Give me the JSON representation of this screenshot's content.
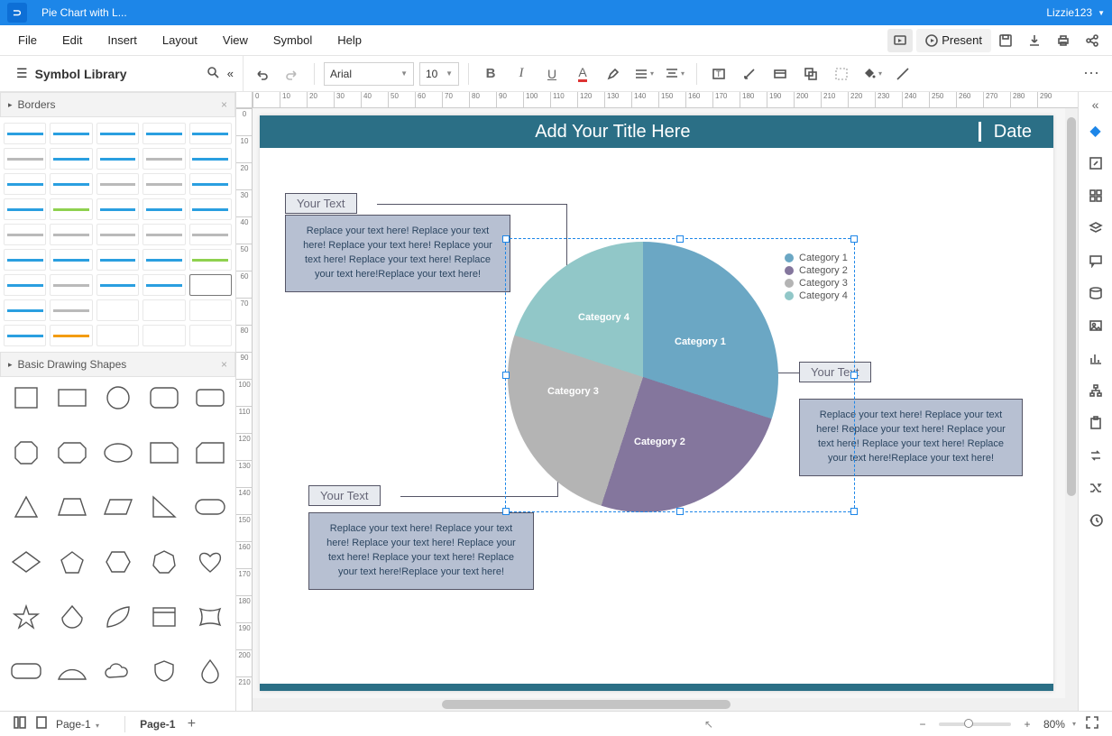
{
  "titlebar": {
    "doc_name": "Pie Chart with L...",
    "user": "Lizzie123"
  },
  "menu": {
    "file": "File",
    "edit": "Edit",
    "insert": "Insert",
    "layout": "Layout",
    "view": "View",
    "symbol": "Symbol",
    "help": "Help",
    "present": "Present"
  },
  "toolbar": {
    "font": "Arial",
    "size": "10"
  },
  "left": {
    "library_title": "Symbol Library",
    "cat_borders": "Borders",
    "cat_shapes": "Basic Drawing Shapes"
  },
  "canvas": {
    "title": "Add Your Title Here",
    "date": "Date",
    "callouts": {
      "tl_label": "Your Text",
      "tl_body": "Replace your text here!   Replace your text here!\nReplace your text here!   Replace your text here!\nReplace your text here!   Replace your text\nhere!Replace your text here!",
      "r_label": "Your Text",
      "r_body": "Replace your text here!   Replace your text here!\nReplace your text here!   Replace your text here!\nReplace your text here!   Replace your text\nhere!Replace your text here!",
      "bl_label": "Your Text",
      "bl_body": "Replace your text here!   Replace your text here!\nReplace your text here!   Replace your text here!\nReplace your text here!   Replace your text\nhere!Replace your text here!"
    },
    "legend": {
      "c1": "Category 1",
      "c2": "Category 2",
      "c3": "Category 3",
      "c4": "Category 4"
    },
    "pie_labels": {
      "c1": "Category 1",
      "c2": "Category 2",
      "c3": "Category 3",
      "c4": "Category 4"
    }
  },
  "chart_data": {
    "type": "pie",
    "title": "Add Your Title Here",
    "series": [
      {
        "name": "Category 1",
        "value": 30,
        "color": "#6ba7c4"
      },
      {
        "name": "Category 2",
        "value": 25,
        "color": "#84769d"
      },
      {
        "name": "Category 3",
        "value": 25,
        "color": "#b4b4b4"
      },
      {
        "name": "Category 4",
        "value": 20,
        "color": "#91c7c8"
      }
    ]
  },
  "status": {
    "page_sel": "Page-1",
    "tab": "Page-1",
    "zoom": "80%"
  },
  "ruler_h": [
    "0",
    "10",
    "20",
    "30",
    "40",
    "50",
    "60",
    "70",
    "80",
    "90",
    "100",
    "110",
    "120",
    "130",
    "140",
    "150",
    "160",
    "170",
    "180",
    "190",
    "200",
    "210",
    "220",
    "230",
    "240",
    "250",
    "260",
    "270",
    "280",
    "290"
  ],
  "ruler_v": [
    "0",
    "10",
    "20",
    "30",
    "40",
    "50",
    "60",
    "70",
    "80",
    "90",
    "100",
    "110",
    "120",
    "130",
    "140",
    "150",
    "160",
    "170",
    "180",
    "190",
    "200",
    "210"
  ]
}
